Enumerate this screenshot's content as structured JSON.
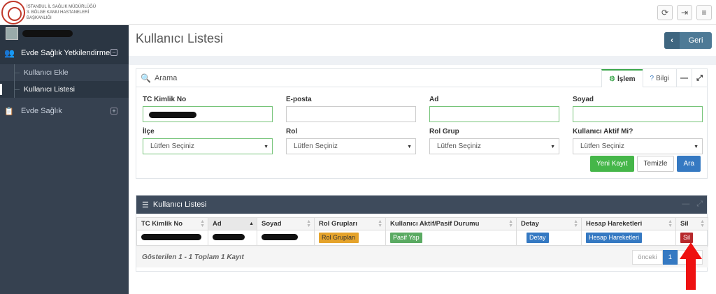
{
  "logo": {
    "line1": "İSTANBUL İL SAĞLIK MÜDÜRLÜĞÜ",
    "line2": "3. BÖLGE KAMU HASTANELERİ",
    "line3": "BAŞKANLIĞI"
  },
  "topbar": {
    "icons": [
      "refresh-icon",
      "logout-icon",
      "menu-icon"
    ]
  },
  "sidebar": {
    "group1": {
      "label": "Evde Sağlık Yetkilendirme",
      "icon": "users-icon"
    },
    "items": [
      {
        "label": "Kullanıcı Ekle"
      },
      {
        "label": "Kullanıcı Listesi"
      }
    ],
    "group2": {
      "label": "Evde Sağlık",
      "icon": "clipboard-icon"
    }
  },
  "page": {
    "title": "Kullanıcı Listesi",
    "back_label": "Geri"
  },
  "search": {
    "title": "Arama",
    "tab_islem": "İşlem",
    "tab_bilgi": "Bilgi",
    "labels": {
      "tc": "TC Kimlik No",
      "eposta": "E-posta",
      "ad": "Ad",
      "soyad": "Soyad",
      "ilce": "İlçe",
      "rol": "Rol",
      "rol_grup": "Rol Grup",
      "aktif": "Kullanıcı Aktif Mi?"
    },
    "select_placeholder": "Lütfen Seçiniz",
    "buttons": {
      "new": "Yeni Kayıt",
      "clear": "Temizle",
      "search": "Ara"
    }
  },
  "list": {
    "title": "Kullanıcı Listesi",
    "columns": [
      "TC Kimlik No",
      "Ad",
      "Soyad",
      "Rol Grupları",
      "Kullanıcı Aktif/Pasif Durumu",
      "Detay",
      "Hesap Hareketleri",
      "Sil"
    ],
    "row": {
      "rol_gruplari": "Rol Grupları",
      "pasif": "Pasif Yap",
      "detay": "Detay",
      "hesap": "Hesap Hareketleri",
      "sil": "Sil"
    },
    "footer": "Gösterilen 1 - 1 Toplam 1 Kayıt",
    "pager": {
      "prev": "önceki",
      "page": "1"
    }
  },
  "colors": {
    "sidebar": "#364150",
    "accent_green": "#45b649",
    "accent_blue": "#3579c2",
    "danger": "#b7282b",
    "annotation_arrow": "#ee1111"
  }
}
